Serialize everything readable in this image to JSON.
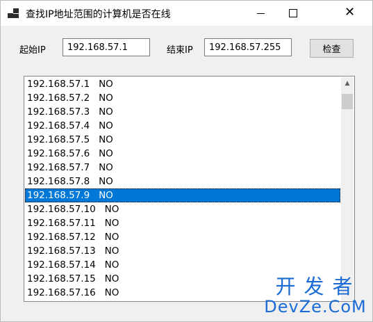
{
  "window": {
    "title": "查找IP地址范围的计算机是否在线",
    "close_glyph": "✕"
  },
  "form": {
    "start_label": "起始IP",
    "start_value": "192.168.57.1",
    "end_label": "结束IP",
    "end_value": "192.168.57.255",
    "check_button": "检查"
  },
  "list": {
    "selected_index": 8,
    "items": [
      {
        "ip": "192.168.57.1",
        "status": "NO"
      },
      {
        "ip": "192.168.57.2",
        "status": "NO"
      },
      {
        "ip": "192.168.57.3",
        "status": "NO"
      },
      {
        "ip": "192.168.57.4",
        "status": "NO"
      },
      {
        "ip": "192.168.57.5",
        "status": "NO"
      },
      {
        "ip": "192.168.57.6",
        "status": "NO"
      },
      {
        "ip": "192.168.57.7",
        "status": "NO"
      },
      {
        "ip": "192.168.57.8",
        "status": "NO"
      },
      {
        "ip": "192.168.57.9",
        "status": "NO"
      },
      {
        "ip": "192.168.57.10",
        "status": "NO"
      },
      {
        "ip": "192.168.57.11",
        "status": "NO"
      },
      {
        "ip": "192.168.57.12",
        "status": "NO"
      },
      {
        "ip": "192.168.57.13",
        "status": "NO"
      },
      {
        "ip": "192.168.57.14",
        "status": "NO"
      },
      {
        "ip": "192.168.57.15",
        "status": "NO"
      },
      {
        "ip": "192.168.57.16",
        "status": "NO"
      }
    ]
  },
  "watermark": {
    "cn": "开发者",
    "en": "DevZe.CoM"
  },
  "colors": {
    "selection": "#0078d7",
    "watermark": "#1a6bd6"
  }
}
